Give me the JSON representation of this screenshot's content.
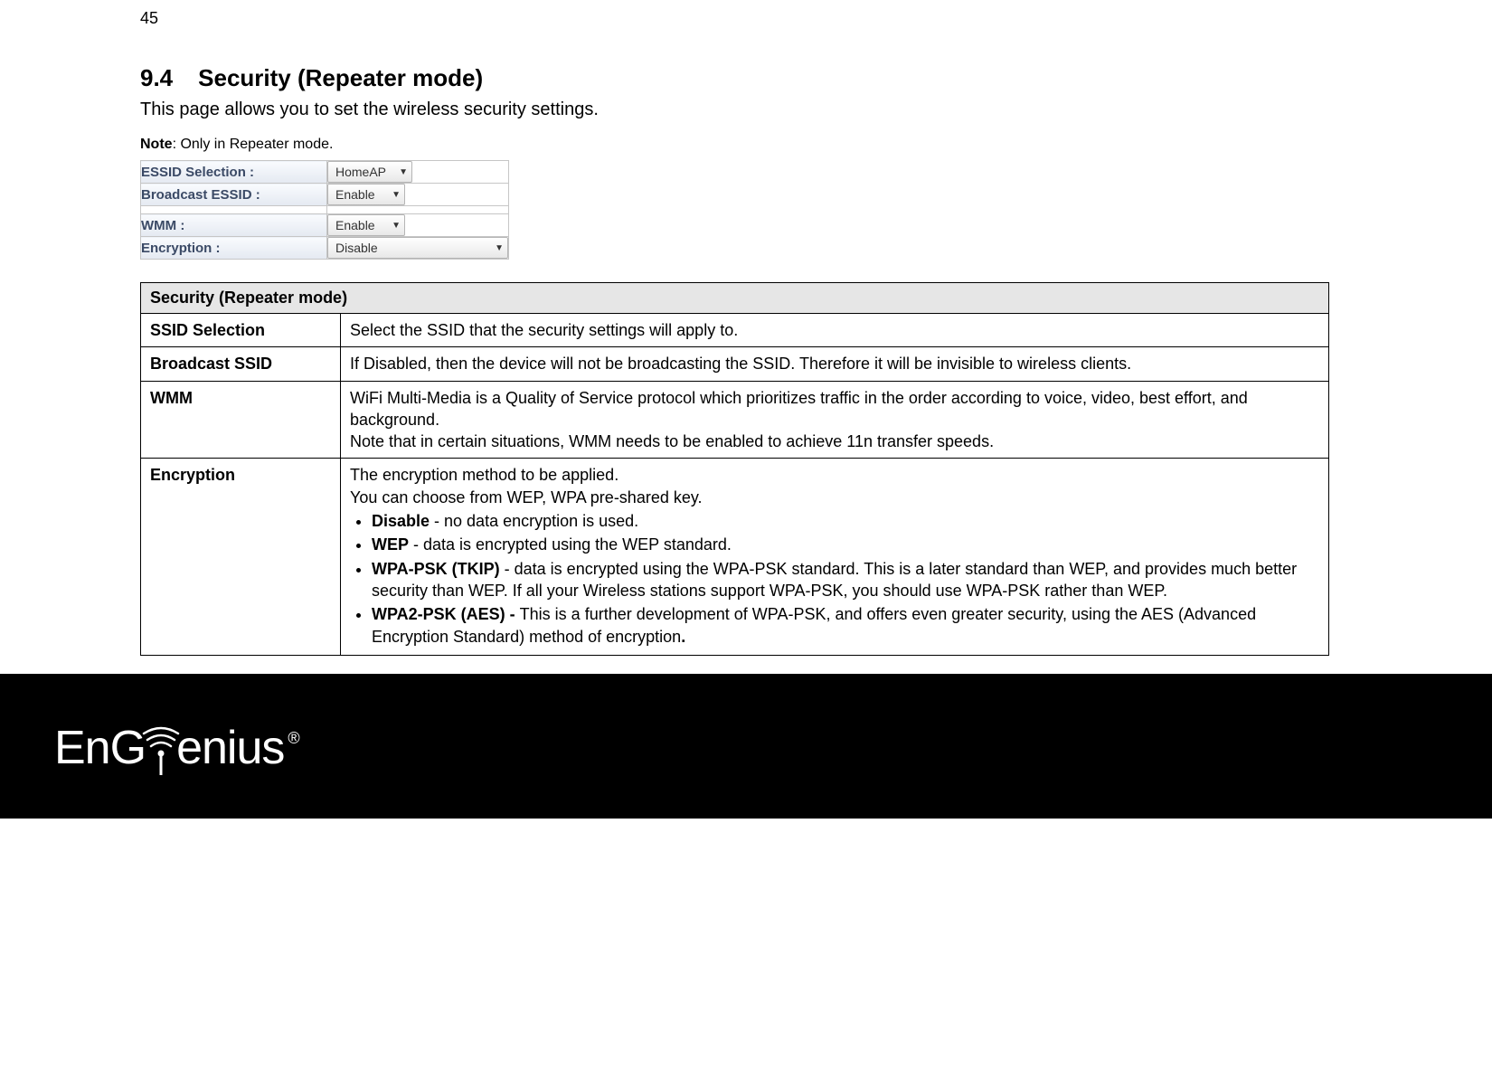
{
  "page_number": "45",
  "heading_number": "9.4",
  "heading_title": "Security (Repeater mode)",
  "intro": "This page allows you to set the wireless security settings.",
  "note_label": "Note",
  "note_text": ": Only in Repeater mode.",
  "form": {
    "essid_label": "ESSID Selection :",
    "essid_value": "HomeAP",
    "broadcast_label": "Broadcast ESSID :",
    "broadcast_value": "Enable",
    "wmm_label": "WMM :",
    "wmm_value": "Enable",
    "encryption_label": "Encryption :",
    "encryption_value": "Disable"
  },
  "desc": {
    "header": "Security (Repeater mode)",
    "rows": {
      "ssid_key": "SSID Selection",
      "ssid_val": "Select the SSID that the security settings will apply to.",
      "broadcast_key": "Broadcast SSID",
      "broadcast_val": "If Disabled, then the device will not be broadcasting the SSID. Therefore it will be invisible to wireless clients.",
      "wmm_key": "WMM",
      "wmm_val_line1": "WiFi Multi-Media is a Quality of Service protocol which prioritizes traffic in the order according to voice, video, best effort, and background.",
      "wmm_val_line2": "Note that in certain situations, WMM needs to be enabled to achieve 11n transfer speeds.",
      "enc_key": "Encryption",
      "enc_intro1": "The encryption method to be applied.",
      "enc_intro2": "You can choose from WEP, WPA pre-shared key.",
      "enc_b1_label": "Disable",
      "enc_b1_text": " - no data encryption is used.",
      "enc_b2_label": "WEP",
      "enc_b2_text": " - data is encrypted using the WEP standard.",
      "enc_b3_label": "WPA-PSK (TKIP)",
      "enc_b3_text": " - data is encrypted using the WPA-PSK standard. This is a later standard than WEP, and provides much better security than WEP. If all your Wireless stations support WPA-PSK, you should use WPA-PSK rather than WEP.",
      "enc_b4_label": "WPA2-PSK (AES) - ",
      "enc_b4_text": "This is a further development of WPA-PSK, and offers even greater security, using the AES (Advanced Encryption Standard) method of encryption",
      "enc_b4_period": "."
    }
  },
  "logo": {
    "part1": "En",
    "part2": "G",
    "part3": "enius",
    "reg": "®"
  }
}
